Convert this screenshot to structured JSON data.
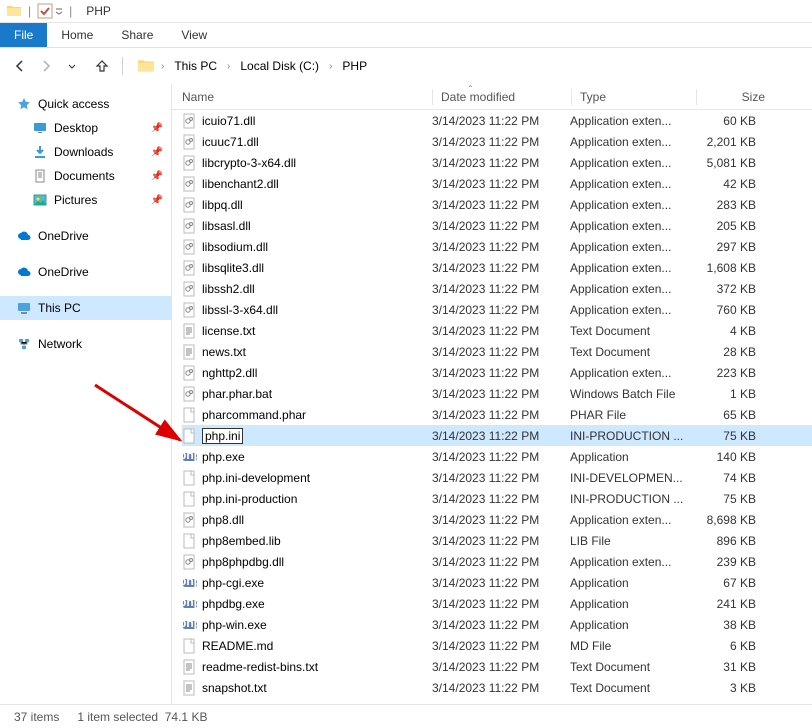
{
  "title": "PHP",
  "tabs": {
    "file": "File",
    "home": "Home",
    "share": "Share",
    "view": "View"
  },
  "breadcrumb": [
    "This PC",
    "Local Disk (C:)",
    "PHP"
  ],
  "columns": {
    "name": "Name",
    "date": "Date modified",
    "type": "Type",
    "size": "Size"
  },
  "nav": {
    "quick_access": "Quick access",
    "desktop": "Desktop",
    "downloads": "Downloads",
    "documents": "Documents",
    "pictures": "Pictures",
    "onedrive1": "OneDrive",
    "onedrive2": "OneDrive",
    "this_pc": "This PC",
    "network": "Network"
  },
  "files": [
    {
      "icon": "dll",
      "name": "icuio71.dll",
      "date": "3/14/2023 11:22 PM",
      "type": "Application exten...",
      "size": "60 KB",
      "selected": false
    },
    {
      "icon": "dll",
      "name": "icuuc71.dll",
      "date": "3/14/2023 11:22 PM",
      "type": "Application exten...",
      "size": "2,201 KB",
      "selected": false
    },
    {
      "icon": "dll",
      "name": "libcrypto-3-x64.dll",
      "date": "3/14/2023 11:22 PM",
      "type": "Application exten...",
      "size": "5,081 KB",
      "selected": false
    },
    {
      "icon": "dll",
      "name": "libenchant2.dll",
      "date": "3/14/2023 11:22 PM",
      "type": "Application exten...",
      "size": "42 KB",
      "selected": false
    },
    {
      "icon": "dll",
      "name": "libpq.dll",
      "date": "3/14/2023 11:22 PM",
      "type": "Application exten...",
      "size": "283 KB",
      "selected": false
    },
    {
      "icon": "dll",
      "name": "libsasl.dll",
      "date": "3/14/2023 11:22 PM",
      "type": "Application exten...",
      "size": "205 KB",
      "selected": false
    },
    {
      "icon": "dll",
      "name": "libsodium.dll",
      "date": "3/14/2023 11:22 PM",
      "type": "Application exten...",
      "size": "297 KB",
      "selected": false
    },
    {
      "icon": "dll",
      "name": "libsqlite3.dll",
      "date": "3/14/2023 11:22 PM",
      "type": "Application exten...",
      "size": "1,608 KB",
      "selected": false
    },
    {
      "icon": "dll",
      "name": "libssh2.dll",
      "date": "3/14/2023 11:22 PM",
      "type": "Application exten...",
      "size": "372 KB",
      "selected": false
    },
    {
      "icon": "dll",
      "name": "libssl-3-x64.dll",
      "date": "3/14/2023 11:22 PM",
      "type": "Application exten...",
      "size": "760 KB",
      "selected": false
    },
    {
      "icon": "txt",
      "name": "license.txt",
      "date": "3/14/2023 11:22 PM",
      "type": "Text Document",
      "size": "4 KB",
      "selected": false
    },
    {
      "icon": "txt",
      "name": "news.txt",
      "date": "3/14/2023 11:22 PM",
      "type": "Text Document",
      "size": "28 KB",
      "selected": false
    },
    {
      "icon": "dll",
      "name": "nghttp2.dll",
      "date": "3/14/2023 11:22 PM",
      "type": "Application exten...",
      "size": "223 KB",
      "selected": false
    },
    {
      "icon": "bat",
      "name": "phar.phar.bat",
      "date": "3/14/2023 11:22 PM",
      "type": "Windows Batch File",
      "size": "1 KB",
      "selected": false
    },
    {
      "icon": "file",
      "name": "pharcommand.phar",
      "date": "3/14/2023 11:22 PM",
      "type": "PHAR File",
      "size": "65 KB",
      "selected": false
    },
    {
      "icon": "file",
      "name": "php.ini",
      "date": "3/14/2023 11:22 PM",
      "type": "INI-PRODUCTION ...",
      "size": "75 KB",
      "selected": true,
      "rename": true
    },
    {
      "icon": "php",
      "name": "php.exe",
      "date": "3/14/2023 11:22 PM",
      "type": "Application",
      "size": "140 KB",
      "selected": false
    },
    {
      "icon": "file",
      "name": "php.ini-development",
      "date": "3/14/2023 11:22 PM",
      "type": "INI-DEVELOPMEN...",
      "size": "74 KB",
      "selected": false
    },
    {
      "icon": "file",
      "name": "php.ini-production",
      "date": "3/14/2023 11:22 PM",
      "type": "INI-PRODUCTION ...",
      "size": "75 KB",
      "selected": false
    },
    {
      "icon": "dll",
      "name": "php8.dll",
      "date": "3/14/2023 11:22 PM",
      "type": "Application exten...",
      "size": "8,698 KB",
      "selected": false
    },
    {
      "icon": "file",
      "name": "php8embed.lib",
      "date": "3/14/2023 11:22 PM",
      "type": "LIB File",
      "size": "896 KB",
      "selected": false
    },
    {
      "icon": "dll",
      "name": "php8phpdbg.dll",
      "date": "3/14/2023 11:22 PM",
      "type": "Application exten...",
      "size": "239 KB",
      "selected": false
    },
    {
      "icon": "php",
      "name": "php-cgi.exe",
      "date": "3/14/2023 11:22 PM",
      "type": "Application",
      "size": "67 KB",
      "selected": false
    },
    {
      "icon": "php",
      "name": "phpdbg.exe",
      "date": "3/14/2023 11:22 PM",
      "type": "Application",
      "size": "241 KB",
      "selected": false
    },
    {
      "icon": "php",
      "name": "php-win.exe",
      "date": "3/14/2023 11:22 PM",
      "type": "Application",
      "size": "38 KB",
      "selected": false
    },
    {
      "icon": "file",
      "name": "README.md",
      "date": "3/14/2023 11:22 PM",
      "type": "MD File",
      "size": "6 KB",
      "selected": false
    },
    {
      "icon": "txt",
      "name": "readme-redist-bins.txt",
      "date": "3/14/2023 11:22 PM",
      "type": "Text Document",
      "size": "31 KB",
      "selected": false
    },
    {
      "icon": "txt",
      "name": "snapshot.txt",
      "date": "3/14/2023 11:22 PM",
      "type": "Text Document",
      "size": "3 KB",
      "selected": false
    }
  ],
  "status": {
    "items": "37 items",
    "selected": "1 item selected",
    "size": "74.1 KB"
  }
}
